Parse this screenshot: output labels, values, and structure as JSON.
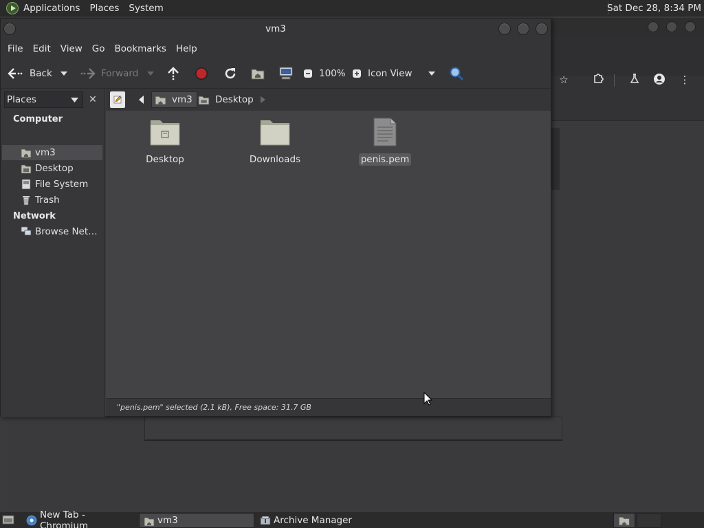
{
  "top_panel": {
    "menus": [
      "Applications",
      "Places",
      "System"
    ],
    "clock": "Sat Dec 28,  8:34 PM"
  },
  "window": {
    "title": "vm3",
    "menu": [
      "File",
      "Edit",
      "View",
      "Go",
      "Bookmarks",
      "Help"
    ],
    "toolbar": {
      "back": "Back",
      "forward": "Forward",
      "zoom": "100%",
      "view_mode": "Icon View"
    },
    "sidebar": {
      "selector": "Places",
      "headings": [
        "Computer",
        "Network"
      ],
      "items": [
        "vm3",
        "Desktop",
        "File System",
        "Trash",
        "Browse Net…"
      ]
    },
    "pathbar": [
      "vm3",
      "Desktop"
    ],
    "files": [
      {
        "name": "Desktop",
        "kind": "folder"
      },
      {
        "name": "Downloads",
        "kind": "folder"
      },
      {
        "name": "penis.pem",
        "kind": "file"
      }
    ],
    "status": "\"penis.pem\" selected (2.1 kB), Free space: 31.7 GB"
  },
  "taskbar": {
    "tasks": [
      "New Tab - Chromium",
      "vm3",
      "Archive Manager"
    ]
  },
  "colors": {
    "panel": "#2b2b2b",
    "window": "#3c3c3e",
    "content": "#434345",
    "folder": "#cfcfbf",
    "stop": "#c0262b"
  }
}
